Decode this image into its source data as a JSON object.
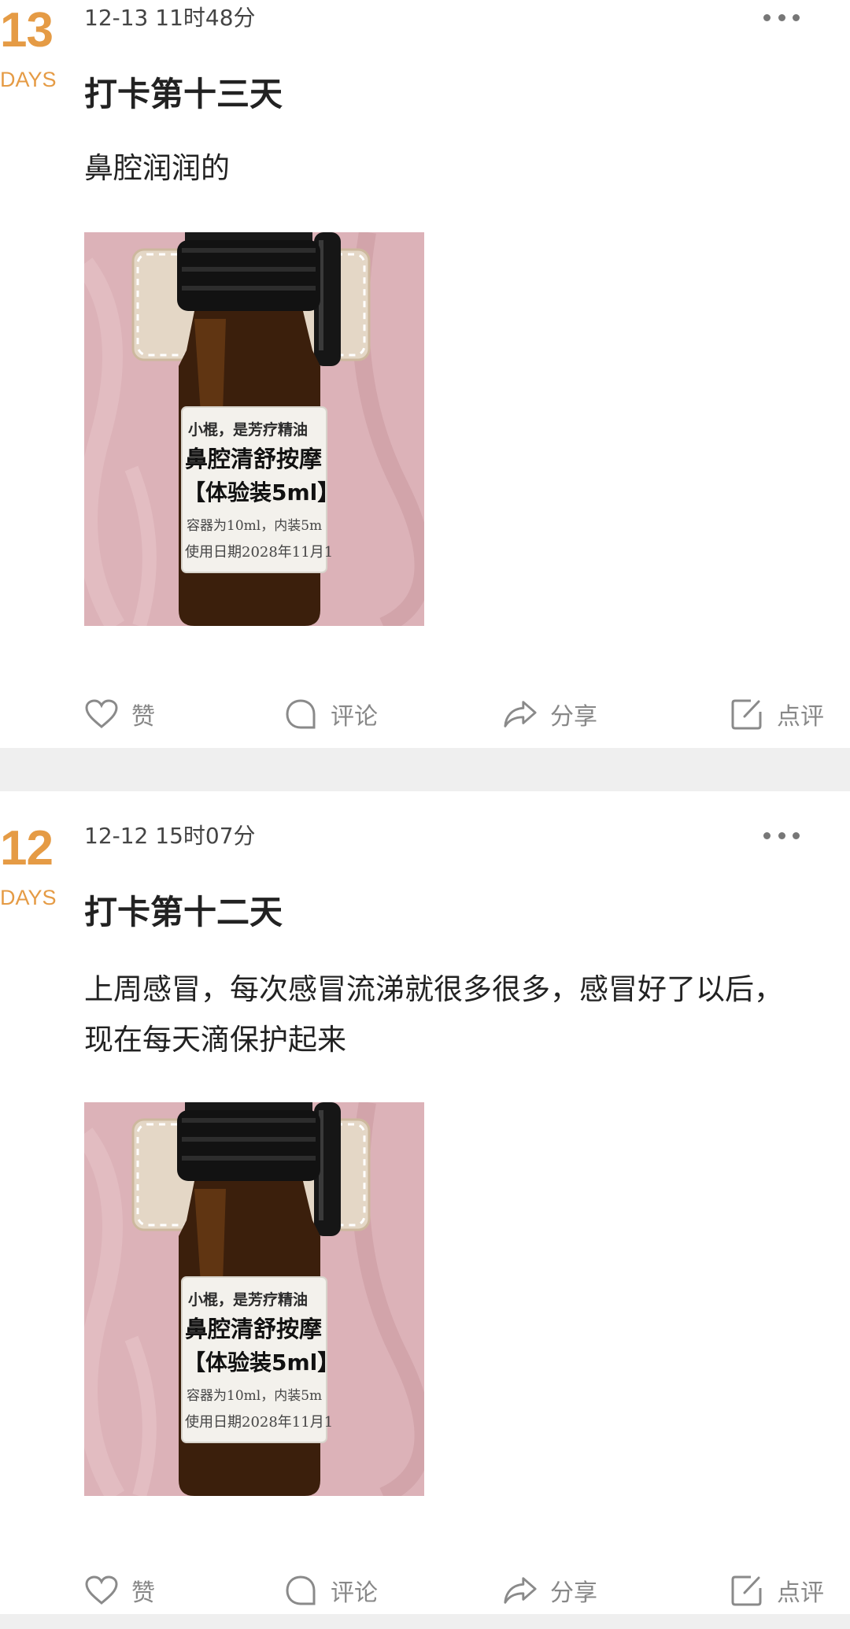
{
  "posts": [
    {
      "day_number": "13",
      "day_unit": "DAYS",
      "timestamp": "12-13 11时48分",
      "title": "打卡第十三天",
      "body": "鼻腔润润的",
      "photo": {
        "label_line1": "小棍，是芳疗精油",
        "label_line2": "鼻腔清舒按摩",
        "label_line3": "【体验装5ml】",
        "label_line4": "容器为10ml，内装5m",
        "label_line5": "使用日期2028年11月1"
      },
      "actions": {
        "like": "赞",
        "comment": "评论",
        "share": "分享",
        "review": "点评"
      }
    },
    {
      "day_number": "12",
      "day_unit": "DAYS",
      "timestamp": "12-12 15时07分",
      "title": "打卡第十二天",
      "body": "上周感冒，每次感冒流涕就很多很多，感冒好了以后，现在每天滴保护起来",
      "photo": {
        "label_line1": "小棍，是芳疗精油",
        "label_line2": "鼻腔清舒按摩",
        "label_line3": "【体验装5ml】",
        "label_line4": "容器为10ml，内装5m",
        "label_line5": "使用日期2028年11月1"
      },
      "actions": {
        "like": "赞",
        "comment": "评论",
        "share": "分享",
        "review": "点评"
      }
    }
  ],
  "icons": {
    "like": "heart-icon",
    "comment": "comment-bubble-icon",
    "share": "share-arrow-icon",
    "review": "edit-note-icon",
    "more": "more-dots-icon"
  },
  "colors": {
    "accent": "#e59b45",
    "text": "#222222",
    "muted": "#888888",
    "separator": "#efefef"
  }
}
